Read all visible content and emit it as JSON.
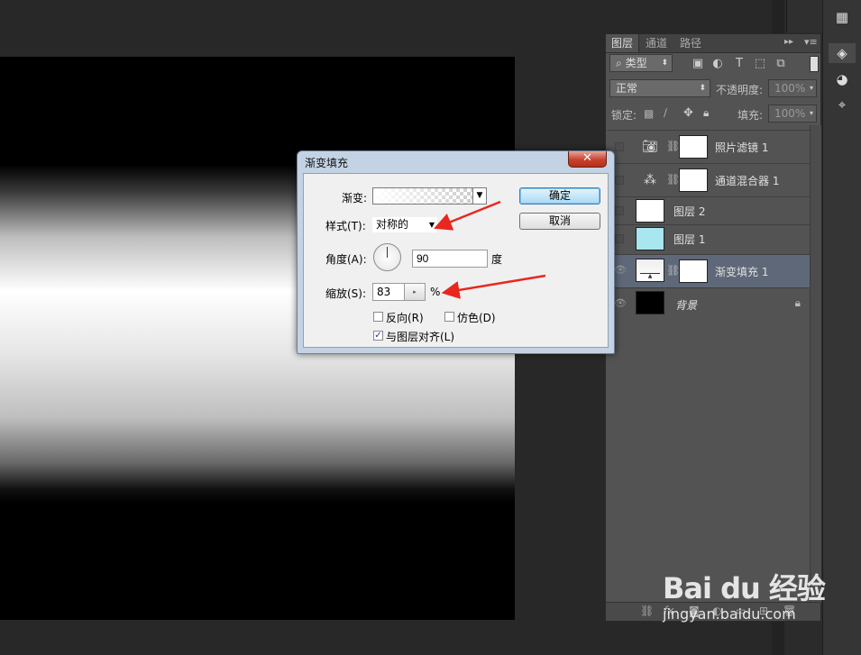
{
  "panel": {
    "tabs": [
      "图层",
      "通道",
      "路径"
    ],
    "filter_kind": "类型",
    "blend_mode": "正常",
    "opacity_label": "不透明度:",
    "opacity_value": "100%",
    "lock_label": "锁定:",
    "fill_label": "填充:",
    "fill_value": "100%",
    "layers": [
      {
        "name": "照片滤镜 1",
        "icon": "camera-icon",
        "visible": false,
        "thumb": "#ffffff"
      },
      {
        "name": "通道混合器 1",
        "icon": "channel-mixer-icon",
        "visible": false,
        "thumb": "#ffffff"
      },
      {
        "name": "图层 2",
        "icon": "",
        "visible": false,
        "thumb": "#ffffff"
      },
      {
        "name": "图层 1",
        "icon": "",
        "visible": false,
        "thumb": "#a8e6f0"
      },
      {
        "name": "渐变填充 1",
        "icon": "gradient-icon",
        "visible": true,
        "selected": true,
        "thumb": "#ffffff"
      },
      {
        "name": "背景",
        "icon": "",
        "visible": true,
        "thumb": "#000000",
        "locked": true
      }
    ]
  },
  "dialog": {
    "title": "渐变填充",
    "close": "✕",
    "gradient_label": "渐变:",
    "style_label": "样式(T):",
    "style_value": "对称的",
    "angle_label": "角度(A):",
    "angle_value": "90",
    "angle_unit": "度",
    "scale_label": "缩放(S):",
    "scale_value": "83",
    "scale_unit": "%",
    "reverse_label": "反向(R)",
    "reverse_checked": false,
    "dither_label": "仿色(D)",
    "dither_checked": false,
    "align_label": "与图层对齐(L)",
    "align_checked": true,
    "ok_label": "确定",
    "cancel_label": "取消"
  },
  "watermark": {
    "logo": "Bai du 经验",
    "url": "jingyan.baidu.com"
  },
  "colors": {
    "selected_row": "#5e6878",
    "arrow": "#e8281e",
    "panel_bg": "#535353"
  }
}
